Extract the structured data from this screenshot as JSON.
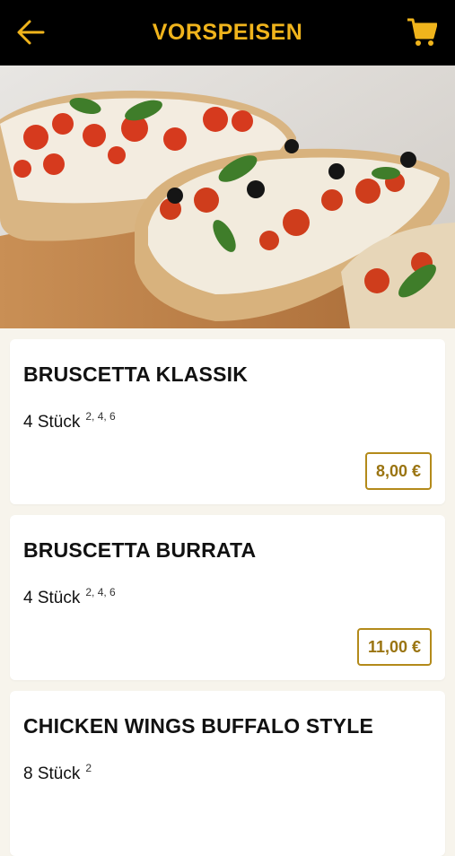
{
  "header": {
    "title": "VORSPEISEN",
    "back_icon": "arrow-left-icon",
    "cart_icon": "shopping-cart-icon",
    "accent": "#f0b41c",
    "background": "#000000"
  },
  "hero": {
    "image": "bruschetta-photo"
  },
  "menu": {
    "items": [
      {
        "name": "BRUSCETTA KLASSIK",
        "desc": "4 Stück",
        "allergens": "2, 4, 6",
        "price": "8,00 €"
      },
      {
        "name": "BRUSCETTA BURRATA",
        "desc": "4 Stück",
        "allergens": "2, 4, 6",
        "price": "11,00 €"
      },
      {
        "name": "CHICKEN WINGS BUFFALO STYLE",
        "desc": "8 Stück",
        "allergens": "2"
      }
    ]
  },
  "colors": {
    "price_border": "#b38a1a",
    "page_bg": "#f7f4ec"
  }
}
